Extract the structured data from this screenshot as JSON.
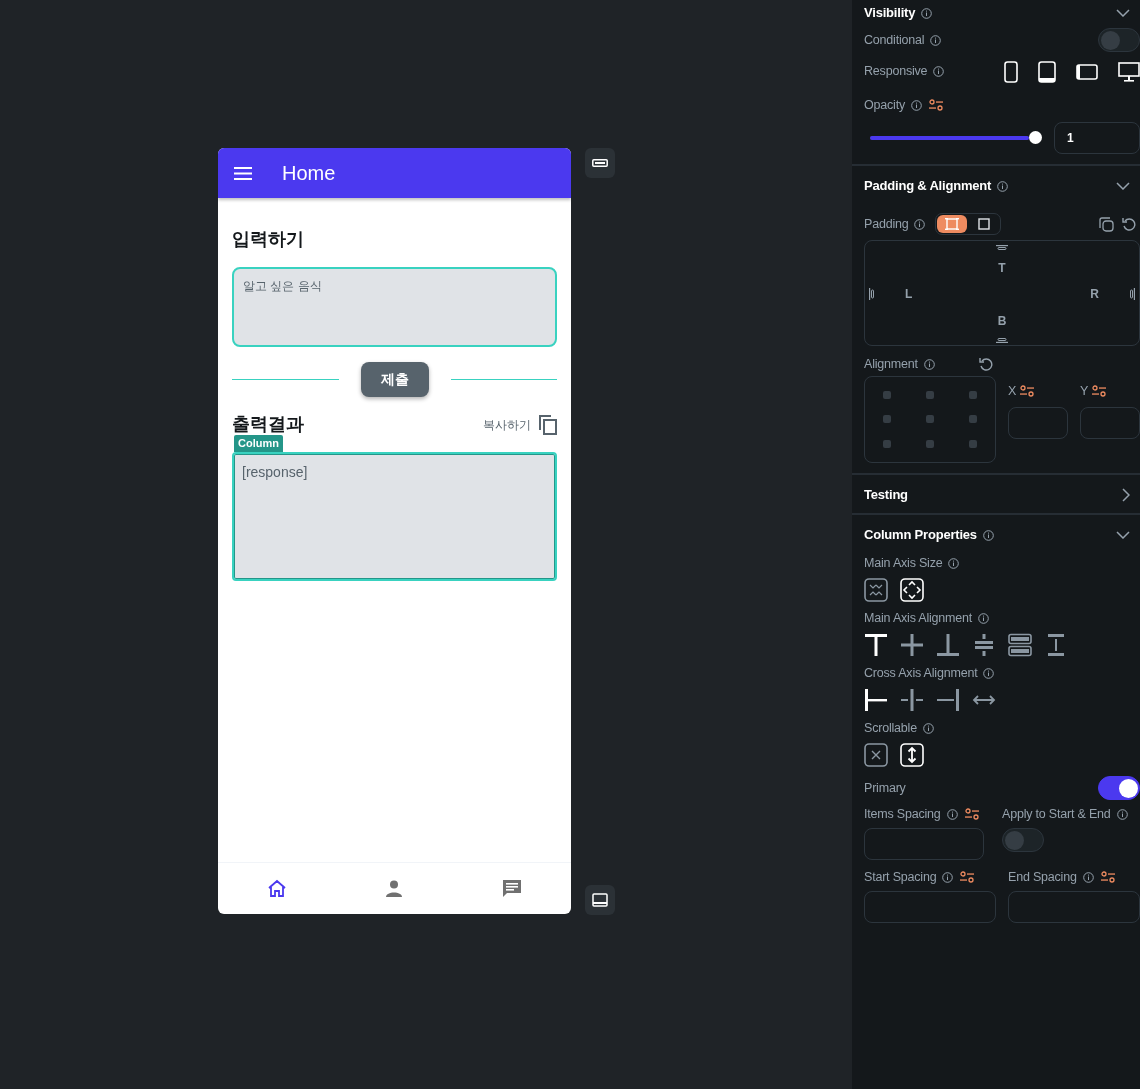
{
  "phone": {
    "app_bar": {
      "title": "Home"
    },
    "input_heading": "입력하기",
    "input_field": {
      "placeholder": "알고 싶은 음식"
    },
    "submit_button": "제출",
    "output_heading": "출력결과",
    "copy_label": "복사하기",
    "selection_tag": "Column",
    "response": "[response]",
    "nav_items": [
      {
        "kind": "home",
        "selected": true
      },
      {
        "kind": "person",
        "selected": false
      },
      {
        "kind": "chat",
        "selected": false
      }
    ]
  },
  "panel": {
    "visibility": {
      "title": "Visibility",
      "expanded": true,
      "conditional": {
        "label": "Conditional",
        "on": false
      },
      "responsive": {
        "label": "Responsive",
        "devices": [
          {
            "kind": "phone"
          },
          {
            "kind": "tablet"
          },
          {
            "kind": "tablet-landscape"
          },
          {
            "kind": "desktop"
          }
        ]
      },
      "opacity": {
        "label": "Opacity",
        "level": 1,
        "value": "1"
      }
    },
    "padding_alignment": {
      "title": "Padding & Alignment",
      "expanded": true,
      "padding": {
        "label": "Padding",
        "modes": [
          {
            "kind": "uniform",
            "selected": true
          },
          {
            "kind": "single",
            "selected": false
          }
        ],
        "sides": {
          "top": "T",
          "left": "L",
          "right": "R",
          "bottom": "B"
        }
      },
      "alignment": {
        "label": "Alignment",
        "x_label": "X",
        "y_label": "Y"
      }
    },
    "testing": {
      "title": "Testing",
      "expanded": false
    },
    "column_properties": {
      "title": "Column Properties",
      "expanded": true,
      "main_axis_size": {
        "label": "Main Axis Size",
        "options": [
          {
            "kind": "shrink",
            "selected": false
          },
          {
            "kind": "expand",
            "selected": true
          }
        ]
      },
      "main_axis_alignment": {
        "label": "Main Axis Alignment",
        "options": [
          {
            "kind": "start",
            "selected": true
          },
          {
            "kind": "center",
            "selected": false
          },
          {
            "kind": "end",
            "selected": false
          },
          {
            "kind": "space-evenly",
            "selected": false
          },
          {
            "kind": "space-between",
            "selected": false
          },
          {
            "kind": "space-around",
            "selected": false
          }
        ]
      },
      "cross_axis_alignment": {
        "label": "Cross Axis Alignment",
        "options": [
          {
            "kind": "start",
            "selected": true
          },
          {
            "kind": "center",
            "selected": false
          },
          {
            "kind": "end",
            "selected": false
          },
          {
            "kind": "stretch",
            "selected": false
          }
        ]
      },
      "scrollable": {
        "label": "Scrollable",
        "options": [
          {
            "kind": "off",
            "selected": false
          },
          {
            "kind": "on",
            "selected": true
          }
        ]
      },
      "primary": {
        "label": "Primary",
        "on": true
      },
      "items_spacing": {
        "label": "Items Spacing"
      },
      "apply_to_start_end": {
        "label": "Apply to Start & End",
        "on": false
      },
      "start_spacing": {
        "label": "Start Spacing"
      },
      "end_spacing": {
        "label": "End Spacing"
      }
    }
  }
}
